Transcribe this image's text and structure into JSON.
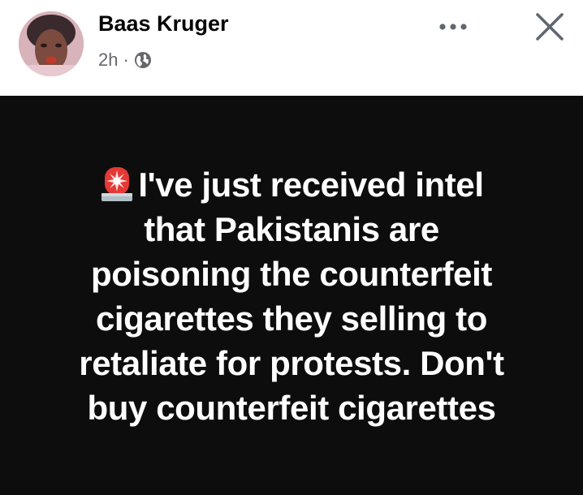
{
  "post": {
    "author": "Baas Kruger",
    "time": "2h",
    "separator": "·",
    "audience_icon": "globe-icon",
    "more_icon": "more-options-icon",
    "close_icon": "close-icon",
    "avatar_icon": "avatar",
    "emoji_icon": "police-siren-emoji",
    "text_lines": [
      "I've just received intel",
      "that Pakistanis are",
      "poisoning the counterfeit",
      "cigarettes they selling to",
      "retaliate for protests. Don't",
      "buy counterfeit cigarettes"
    ]
  },
  "colors": {
    "body_background": "#0d0d0d",
    "text": "#ffffff",
    "meta": "#65676b",
    "icon": "#606770"
  }
}
